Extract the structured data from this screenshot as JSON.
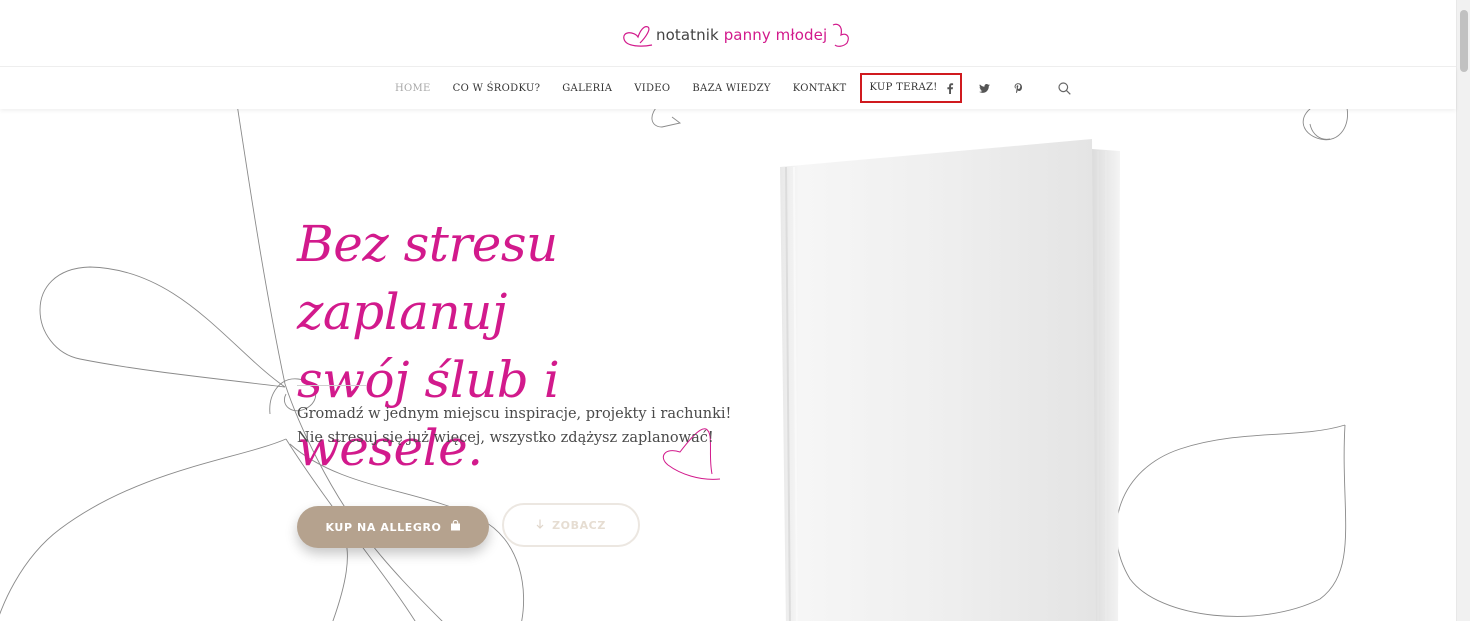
{
  "logo": {
    "prefix": "notatnik",
    "highlight": "panny młodej"
  },
  "nav": {
    "items": [
      {
        "label": "HOME",
        "active": true
      },
      {
        "label": "CO W ŚRODKU?",
        "active": false
      },
      {
        "label": "GALERIA",
        "active": false
      },
      {
        "label": "VIDEO",
        "active": false
      },
      {
        "label": "BAZA WIEDZY",
        "active": false
      },
      {
        "label": "KONTAKT",
        "active": false
      },
      {
        "label": "KUP TERAZ!",
        "active": false,
        "highlighted": true
      }
    ],
    "social_icons": [
      "facebook-icon",
      "twitter-icon",
      "pinterest-icon"
    ],
    "search_icon": "search-icon"
  },
  "hero": {
    "headline_line1": "Bez stresu zaplanuj",
    "headline_line2": "swój ślub i wesele.",
    "subtext_line1": "Gromadź w jednym miejscu inspiracje, projekty i rachunki!",
    "subtext_line2": "Nie stresuj się już więcej, wszystko zdążysz zaplanować!",
    "buy_button": "KUP NA ALLEGRO",
    "see_button": "ZOBACZ"
  },
  "colors": {
    "brand_pink": "#d21a8c",
    "button_tan": "#b5a28e",
    "highlight_border": "#d01a1f"
  }
}
